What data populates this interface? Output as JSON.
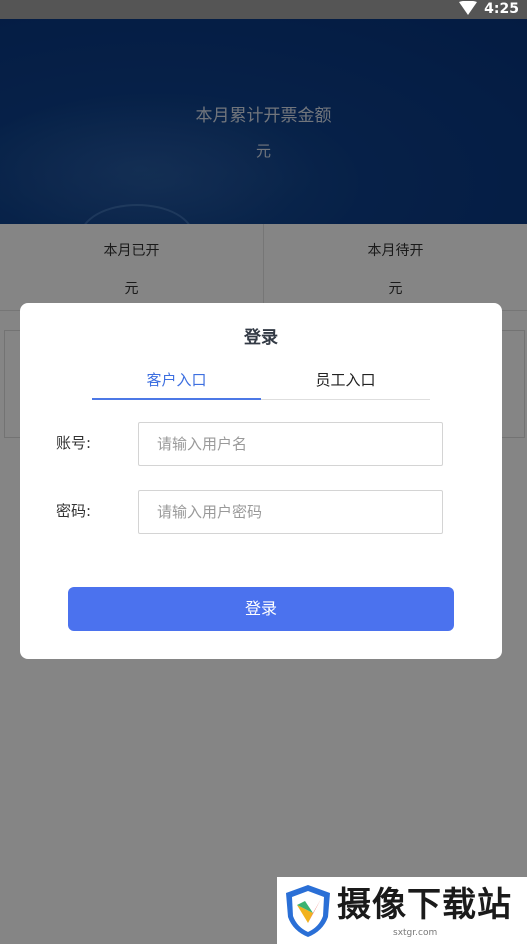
{
  "status_bar": {
    "time": "4:25"
  },
  "banner": {
    "title": "本月累计开票金额",
    "unit": "元"
  },
  "stats": {
    "issued_label": "本月已开",
    "issued_unit": "元",
    "pending_label": "本月待开",
    "pending_unit": "元"
  },
  "login_dialog": {
    "title": "登录",
    "tabs": [
      {
        "label": "客户入口",
        "active": true
      },
      {
        "label": "员工入口",
        "active": false
      }
    ],
    "username": {
      "label": "账号:",
      "placeholder": "请输入用户名",
      "value": ""
    },
    "password": {
      "label": "密码:",
      "placeholder": "请输入用户密码",
      "value": ""
    },
    "submit_label": "登录"
  },
  "watermark": {
    "name": "摄像下载站",
    "domain": "sxtgr.com"
  },
  "colors": {
    "banner_blue": "#0d3f8a",
    "accent_blue": "#4b72ee",
    "tab_active": "#3d6fe0"
  },
  "icons": [
    "wifi-icon",
    "watermark-logo-icon"
  ]
}
